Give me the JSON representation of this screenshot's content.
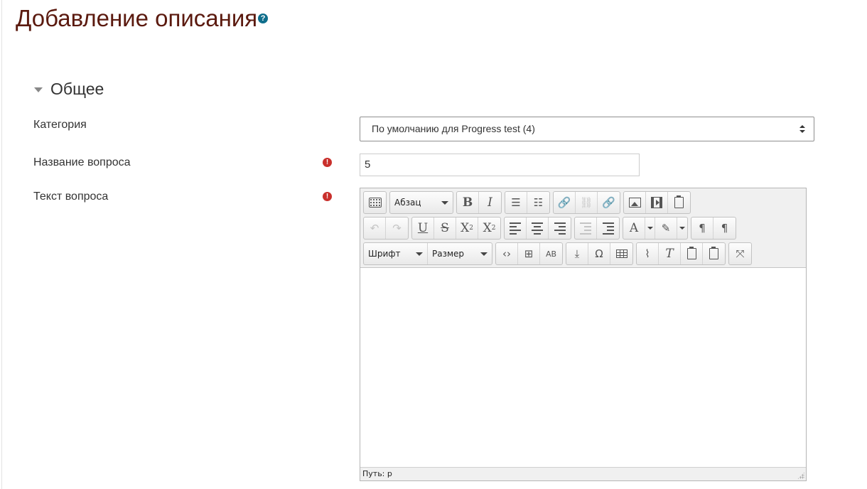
{
  "page": {
    "title": "Добавление описания",
    "help_icon": "help-icon"
  },
  "section": {
    "title": "Общее",
    "icon": "collapse-icon"
  },
  "fields": {
    "category": {
      "label": "Категория",
      "value": "По умолчанию для Progress test (4)"
    },
    "name": {
      "label": "Название вопроса",
      "value": "5",
      "required_icon": "required-icon"
    },
    "text": {
      "label": "Текст вопроса",
      "required_icon": "required-icon"
    }
  },
  "editor": {
    "toolbar": {
      "format_select": "Абзац",
      "font_select": "Шрифт",
      "size_select": "Размер"
    },
    "content": "",
    "status_path": "Путь: p"
  },
  "colors": {
    "title": "#5b1a0f",
    "required": "#c9302c",
    "help": "#0f6e8c"
  }
}
